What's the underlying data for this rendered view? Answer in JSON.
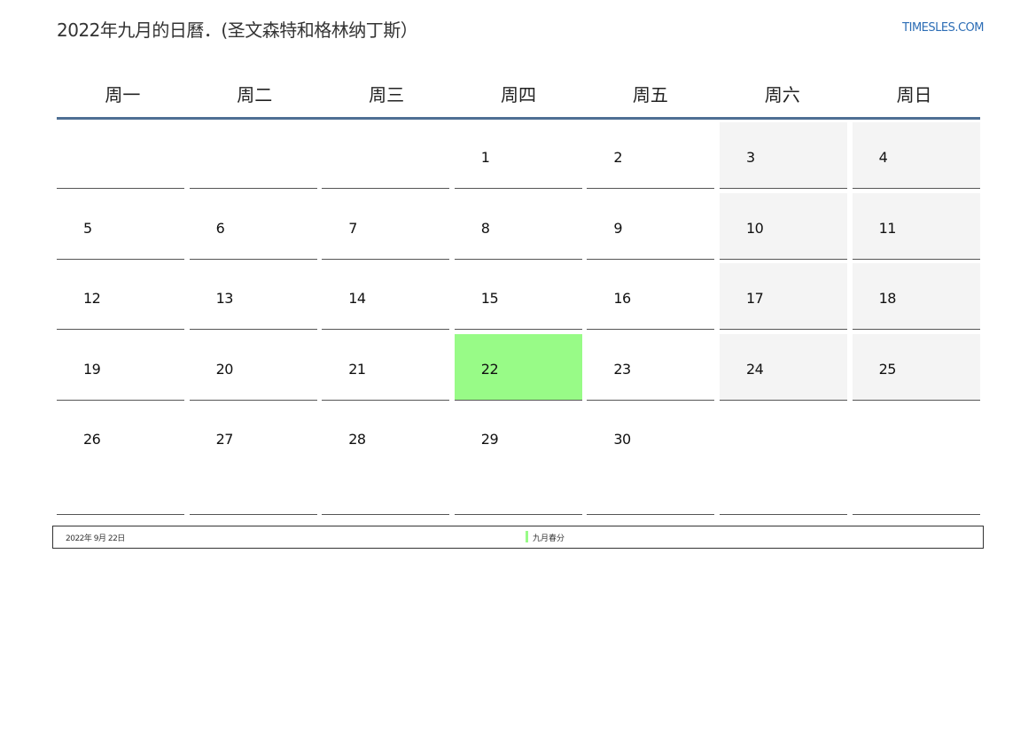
{
  "header": {
    "title": "2022年九月的日曆．(圣文森特和格林纳丁斯）",
    "brand": "TIMESLES.COM"
  },
  "weekdays": [
    "周一",
    "周二",
    "周三",
    "周四",
    "周五",
    "周六",
    "周日"
  ],
  "days": [
    "",
    "",
    "",
    "1",
    "2",
    "3",
    "4",
    "5",
    "6",
    "7",
    "8",
    "9",
    "10",
    "11",
    "12",
    "13",
    "14",
    "15",
    "16",
    "17",
    "18",
    "19",
    "20",
    "21",
    "22",
    "23",
    "24",
    "25",
    "26",
    "27",
    "28",
    "29",
    "30",
    "",
    ""
  ],
  "highlight_day": "22",
  "colors": {
    "holiday": "#98fb87",
    "weekend_fill": "#f4f4f4",
    "header_rule": "#4f6f94",
    "brand": "#2c6db5"
  },
  "legend": {
    "date": "2022年 9月 22日",
    "event": "九月春分"
  }
}
